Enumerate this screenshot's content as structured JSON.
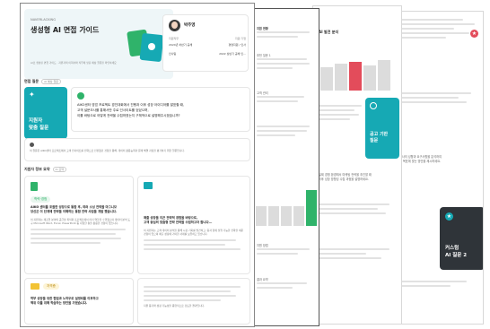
{
  "main": {
    "brand": "NAVERLACKING",
    "title": "생성형 AI 면접 가이드",
    "subtitle": "AI로 생성된 면접 가이드 · 지원자의 이력서와 직무에 맞춘 예상 질문을 확인하세요",
    "profile": {
      "name": "박주영",
      "row1": [
        "지원직무",
        "지원 기업"
      ],
      "row2": [
        "2024년 하반기 공채",
        "경영지원 / 인사"
      ],
      "row3": [
        "인사팀",
        "2022 상반기 공채 인..."
      ]
    },
    "section1": {
      "title": "면접 질문",
      "tag": "AI 예상 질문"
    },
    "ai_tile": {
      "line1": "지원자",
      "line2": "맞춤 질문"
    },
    "q_card": {
      "text1": "AIKO센터 영업 프로젝트 경진대회에서 진행과 이후 성장 아이디어를 발표할 때,",
      "text2": "고객 설문조사를 통해서만 주로 인사이트를 얻었으며,",
      "text3": "이를 바탕으로 어떻게 전략을 수립하였는지 구체적으로 설명해주시겠습니까?"
    },
    "info_text": "이 질문은 AIKO센터 프로젝트에서 고객 인사이트를 전략으로 전환했던 경험을 통해, 데이터 활용능력과 문제 해결 과정을 평가하기 위한 질문입니다.",
    "section2": {
      "title": "지원자 정보 요약",
      "tag": "AI 요약"
    },
    "col1": {
      "badge": "학력·경험",
      "heading1": "AIKO 센터를 포괄한 성장으로 통합 후, 여러 소싱 전략을 마그니모",
      "heading2": "당신은 이 단계에 전략을 이해하는 통합 전략 사업을 개발 했습니다.",
      "body": "이 지원자는 제조업 분야의 공급망 최적화 프로젝트에서 리더 역할을 수행했으며 데이터 분석 도구 Microsoft Word, Excel, PowerPoint 등 다양한 툴을 활용한 경험이 있습니다.",
      "badge2": "자격증",
      "bottom1": "학부 성장을 위한 협업과 노하우로 설명되를 이후하고",
      "bottom2": "책위 이를 위해 학습하는 방안을 가졌습니다."
    },
    "col2": {
      "heading1": "매출 성장을 이끈 전략적 경험을 바탕으로,",
      "heading2": "고객 중심의 맞춤형 전략 전략을 수립하고자 합니다...",
      "body": "이 지원자는 고객 데이터 분석을 통해 시장 기회를 발견하고, 팀과 함께 실행 가능한 전략을 세운 경험이 있으며 매출 성장에 기여한 사례를 보유하고 있습니다.",
      "bottom": "지원 동기와 성장 가능성을 종합적으로 검토한 결과입니다."
    }
  },
  "back1": {
    "lines": [
      "지원 현황",
      "추천 질문 1",
      "고객 관리",
      "지원 방법",
      "결과 요약"
    ]
  },
  "back2": {
    "section": "AI 발견 분석",
    "tile": {
      "line1": "공고 기반",
      "line2": "질문"
    },
    "text1": "실제 경쟁 환경에서 마케팅 전략을 추진할 때",
    "text2": "이후 성장 방향성 수립 과정을 설명하세요."
  },
  "back3": {
    "tile": {
      "line1": "커스텀",
      "line2": "AI 질문 2"
    },
    "text1": "고객사의 성향과 요구사항을 분석하여",
    "text2": "조직 목표에 맞는 방안을 제시하세요."
  },
  "colors": {
    "teal": "#16a9b4",
    "green": "#2fb36a",
    "red": "#e34c5b",
    "dark": "#2f3439"
  }
}
